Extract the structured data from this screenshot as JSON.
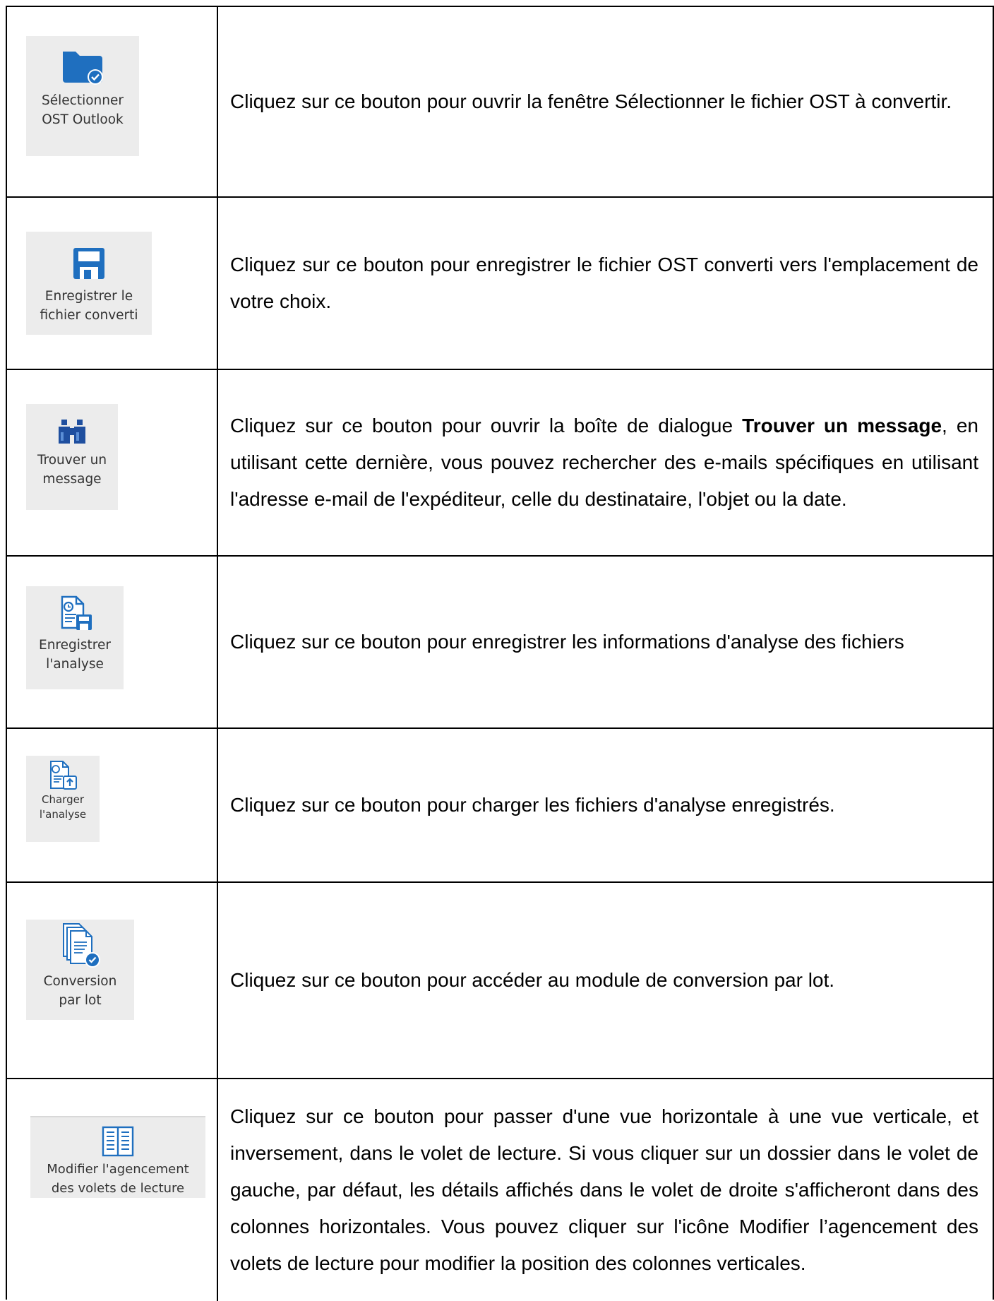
{
  "rows": [
    {
      "button_label": "Sélectionner\nOST Outlook",
      "description": "Cliquez sur ce bouton pour ouvrir la fenêtre Sélectionner le fichier OST à convertir."
    },
    {
      "button_label": "Enregistrer le\nfichier converti",
      "description": "Cliquez sur ce bouton pour enregistrer le fichier OST converti vers l'emplacement de votre choix."
    },
    {
      "button_label": "Trouver un\nmessage",
      "description_before": "Cliquez sur ce bouton pour ouvrir la boîte de dialogue ",
      "description_bold": "Trouver un message",
      "description_after": ", en utilisant cette dernière, vous pouvez rechercher des e-mails spécifiques en utilisant l'adresse e-mail de l'expéditeur, celle du destinataire, l'objet ou la date."
    },
    {
      "button_label": "Enregistrer\nl'analyse",
      "description": "Cliquez sur ce bouton pour enregistrer les informations d'analyse des fichiers"
    },
    {
      "button_label": "Charger\nl'analyse",
      "description": "Cliquez sur ce bouton pour charger les fichiers d'analyse enregistrés."
    },
    {
      "button_label": "Conversion\npar lot",
      "description": "Cliquez sur ce bouton pour accéder au module de conversion par lot."
    },
    {
      "button_label": "Modifier l'agencement\ndes volets de lecture",
      "description": "Cliquez sur ce bouton pour passer d'une vue horizontale à une vue verticale, et inversement, dans le volet de lecture. Si vous cliquer sur un dossier dans le volet de gauche, par défaut, les détails affichés dans le volet de droite s'afficheront dans des colonnes horizontales. Vous pouvez cliquer sur l'icône Modifier l’agencement des volets de lecture pour modifier la position des colonnes verticales."
    }
  ],
  "icons": [
    "folder-check-icon",
    "floppy-disk-icon",
    "binoculars-icon",
    "save-scan-icon",
    "load-scan-icon",
    "batch-conversion-icon",
    "reading-pane-layout-icon"
  ],
  "colors": {
    "icon_blue": "#1f6fbf",
    "button_bg": "#ececec"
  }
}
